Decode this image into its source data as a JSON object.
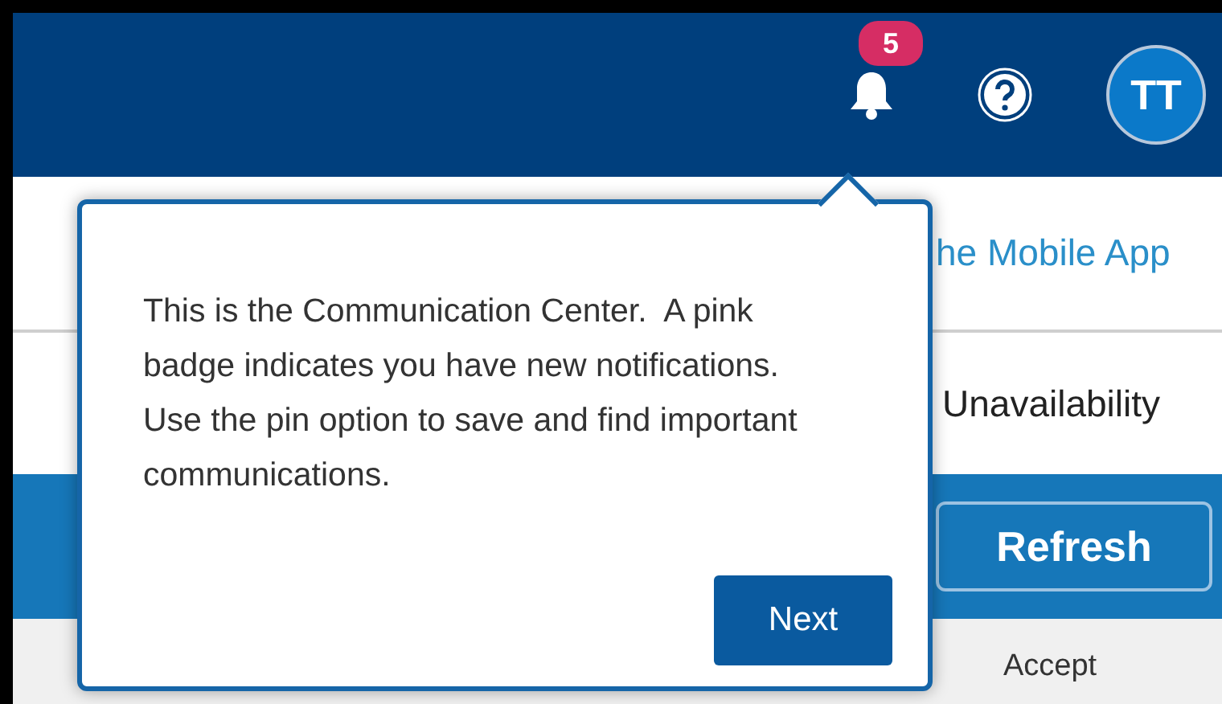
{
  "header": {
    "notifications": {
      "count": "5"
    },
    "avatar": {
      "initials": "TT"
    }
  },
  "rows": [
    {
      "kind": "link",
      "text": "he Mobile App"
    },
    {
      "kind": "label",
      "text": "Unavailability"
    },
    {
      "kind": "button",
      "text": "Refresh"
    },
    {
      "kind": "column_header",
      "text": "Accept"
    }
  ],
  "popover": {
    "text": "This is the Communication Center.  A pink badge indicates you have new notifications.  Use the pin option to save and find important communications.",
    "button": "Next"
  }
}
